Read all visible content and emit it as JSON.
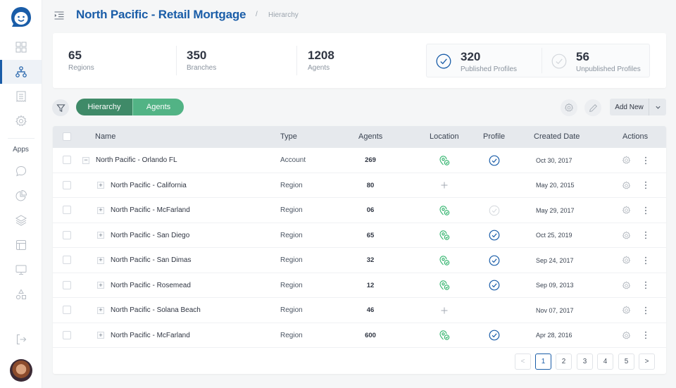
{
  "app": {
    "title": "North Pacific - Retail Mortgage",
    "breadcrumb_separator": "/",
    "breadcrumb": "Hierarchy"
  },
  "sidebar": {
    "items": [
      {
        "name": "dashboard",
        "icon": "grid-icon",
        "active": false
      },
      {
        "name": "hierarchy",
        "icon": "hierarchy-icon",
        "active": true
      },
      {
        "name": "documents",
        "icon": "receipt-icon",
        "active": false
      },
      {
        "name": "settings",
        "icon": "gear-icon",
        "active": false
      }
    ],
    "apps_label": "Apps",
    "apps": [
      {
        "name": "chat",
        "icon": "chat-icon"
      },
      {
        "name": "reports",
        "icon": "pie-chart-icon"
      },
      {
        "name": "layers",
        "icon": "layers-icon"
      },
      {
        "name": "layout",
        "icon": "layout-icon"
      },
      {
        "name": "display",
        "icon": "monitor-icon"
      },
      {
        "name": "shapes",
        "icon": "shapes-icon"
      }
    ],
    "logout_icon": "logout-icon"
  },
  "stats": {
    "regions": {
      "value": "65",
      "label": "Regions"
    },
    "branches": {
      "value": "350",
      "label": "Branches"
    },
    "agents": {
      "value": "1208",
      "label": "Agents"
    },
    "published": {
      "value": "320",
      "label": "Published Profiles"
    },
    "unpublished": {
      "value": "56",
      "label": "Unpublished Profiles"
    }
  },
  "toolbar": {
    "tabs": [
      {
        "label": "Hierarchy",
        "active": true
      },
      {
        "label": "Agents",
        "active": false
      }
    ],
    "add_new_label": "Add New"
  },
  "table": {
    "columns": [
      "Name",
      "Type",
      "Agents",
      "Location",
      "Profile",
      "Created Date",
      "Actions"
    ],
    "rows": [
      {
        "name": "North Pacific - Orlando FL",
        "level": 0,
        "expanded": true,
        "type": "Account",
        "agents": "269",
        "location": "verified",
        "profile": "published",
        "date": "Oct 30, 2017"
      },
      {
        "name": "North Pacific - California",
        "level": 1,
        "expanded": false,
        "type": "Region",
        "agents": "80",
        "location": "add",
        "profile": "none",
        "date": "May 20, 2015"
      },
      {
        "name": "North Pacific - McFarland",
        "level": 1,
        "expanded": false,
        "type": "Region",
        "agents": "06",
        "location": "verified",
        "profile": "unpublished",
        "date": "May 29, 2017"
      },
      {
        "name": "North Pacific - San Diego",
        "level": 1,
        "expanded": false,
        "type": "Region",
        "agents": "65",
        "location": "verified",
        "profile": "published",
        "date": "Oct 25, 2019"
      },
      {
        "name": "North Pacific - San Dimas",
        "level": 1,
        "expanded": false,
        "type": "Region",
        "agents": "32",
        "location": "verified",
        "profile": "published",
        "date": "Sep 24, 2017"
      },
      {
        "name": "North Pacific - Rosemead",
        "level": 1,
        "expanded": false,
        "type": "Region",
        "agents": "12",
        "location": "verified",
        "profile": "published",
        "date": "Sep 09, 2013"
      },
      {
        "name": "North Pacific - Solana Beach",
        "level": 1,
        "expanded": false,
        "type": "Region",
        "agents": "46",
        "location": "add",
        "profile": "none",
        "date": "Nov 07, 2017"
      },
      {
        "name": "North Pacific - McFarland",
        "level": 1,
        "expanded": false,
        "type": "Region",
        "agents": "600",
        "location": "verified",
        "profile": "published",
        "date": "Apr 28, 2016"
      }
    ]
  },
  "pagination": {
    "prev": "<",
    "pages": [
      "1",
      "2",
      "3",
      "4",
      "5"
    ],
    "current": "1",
    "next": ">"
  },
  "colors": {
    "brand": "#1a5da8",
    "green": "#2fb36b",
    "tab_active": "#3f8a68",
    "tab_inactive": "#52b385"
  }
}
